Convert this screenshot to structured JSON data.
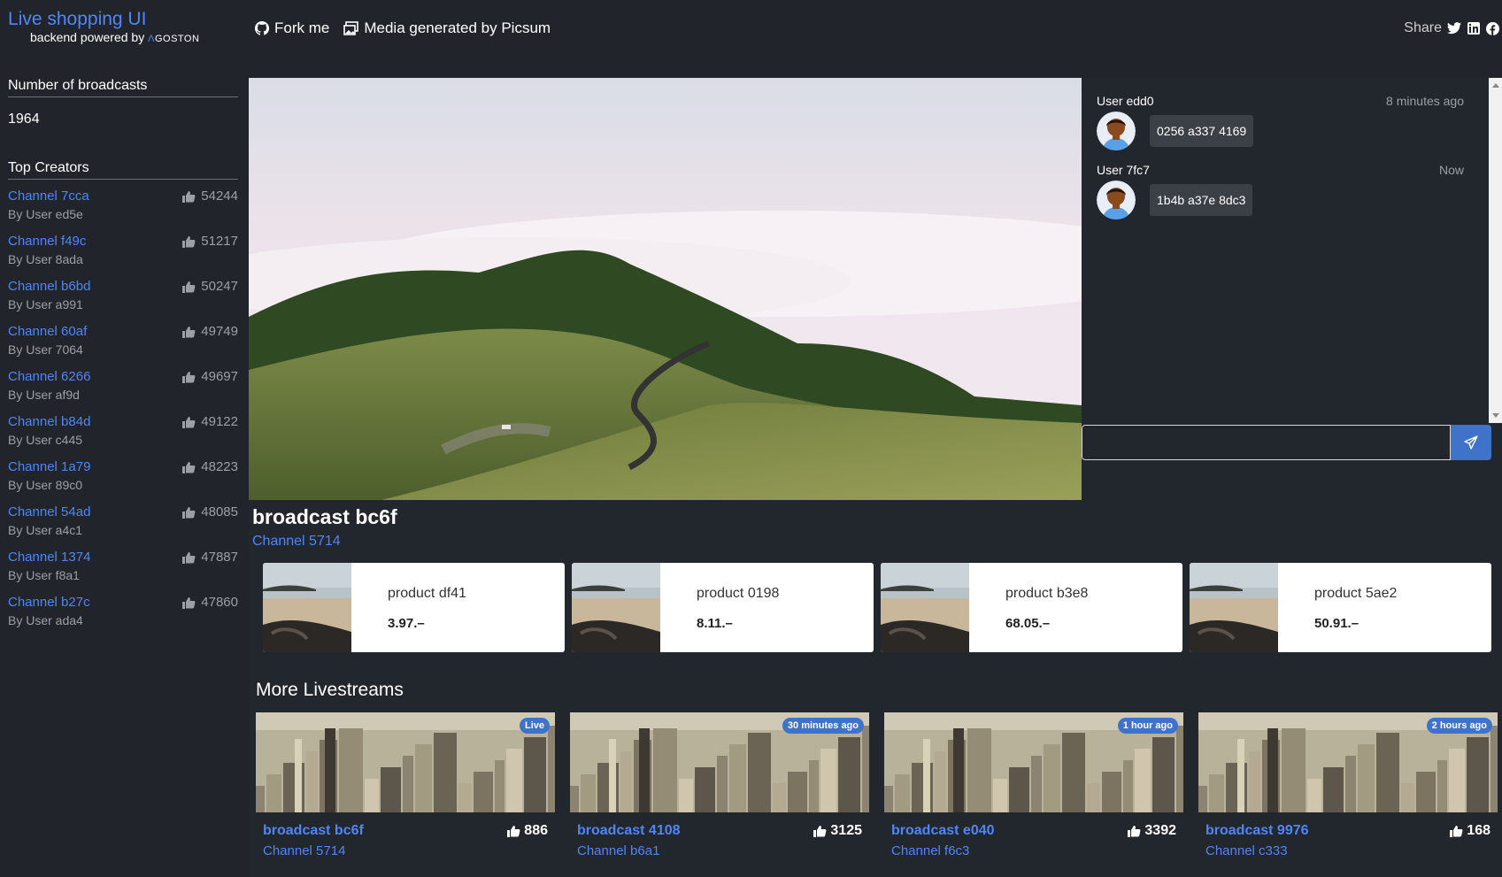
{
  "header": {
    "title": "Live shopping UI",
    "subtitle": "backend powered by",
    "subtitle_logo": "GOSTON",
    "nav": [
      {
        "label": "Fork me",
        "icon": "github-icon"
      },
      {
        "label": "Media generated by Picsum",
        "icon": "images-icon"
      }
    ],
    "share_label": "Share",
    "share_icons": [
      "twitter-icon",
      "linkedin-icon",
      "facebook-icon"
    ]
  },
  "sidebar": {
    "broadcasts_heading": "Number of broadcasts",
    "broadcasts_count": "1964",
    "top_creators_heading": "Top Creators",
    "creators": [
      {
        "channel": "Channel 7cca",
        "by": "By User ed5e",
        "likes": "54244"
      },
      {
        "channel": "Channel f49c",
        "by": "By User 8ada",
        "likes": "51217"
      },
      {
        "channel": "Channel b6bd",
        "by": "By User a991",
        "likes": "50247"
      },
      {
        "channel": "Channel 60af",
        "by": "By User 7064",
        "likes": "49749"
      },
      {
        "channel": "Channel 6266",
        "by": "By User af9d",
        "likes": "49697"
      },
      {
        "channel": "Channel b84d",
        "by": "By User c445",
        "likes": "49122"
      },
      {
        "channel": "Channel 1a79",
        "by": "By User 89c0",
        "likes": "48223"
      },
      {
        "channel": "Channel 54ad",
        "by": "By User a4c1",
        "likes": "48085"
      },
      {
        "channel": "Channel 1374",
        "by": "By User f8a1",
        "likes": "47887"
      },
      {
        "channel": "Channel b27c",
        "by": "By User ada4",
        "likes": "47860"
      }
    ]
  },
  "chat": {
    "messages": [
      {
        "user": "User edd0",
        "time": "8 minutes ago",
        "text": "0256 a337 4169"
      },
      {
        "user": "User 7fc7",
        "time": "Now",
        "text": "1b4b a37e 8dc3"
      }
    ],
    "input_value": ""
  },
  "broadcast": {
    "title": "broadcast bc6f",
    "channel": "Channel 5714"
  },
  "products": [
    {
      "name": "product df41",
      "price": "3.97.–"
    },
    {
      "name": "product 0198",
      "price": "8.11.–"
    },
    {
      "name": "product b3e8",
      "price": "68.05.–"
    },
    {
      "name": "product 5ae2",
      "price": "50.91.–"
    }
  ],
  "more": {
    "heading": "More Livestreams",
    "streams": [
      {
        "title": "broadcast bc6f",
        "channel": "Channel 5714",
        "likes": "886",
        "badge": "Live"
      },
      {
        "title": "broadcast 4108",
        "channel": "Channel b6a1",
        "likes": "3125",
        "badge": "30 minutes ago"
      },
      {
        "title": "broadcast e040",
        "channel": "Channel f6c3",
        "likes": "3392",
        "badge": "1 hour ago"
      },
      {
        "title": "broadcast 9976",
        "channel": "Channel c333",
        "likes": "168",
        "badge": "2 hours ago"
      }
    ]
  },
  "colors": {
    "background": "#21252b",
    "accent": "#4f86f7",
    "badge": "#3f73c9",
    "send_button": "#3f73c9"
  }
}
